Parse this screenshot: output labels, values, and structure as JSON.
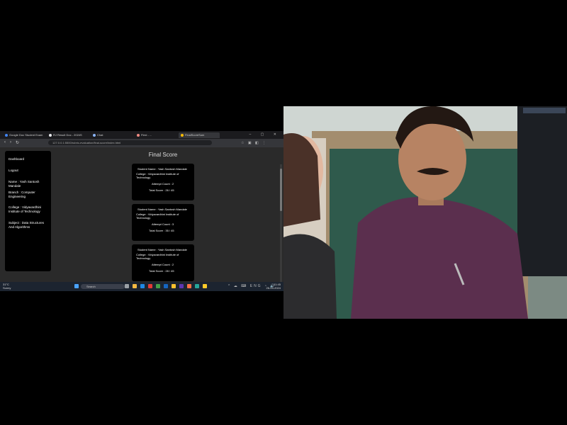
{
  "browser": {
    "tabs": [
      {
        "label": "Google Doc Student Exam",
        "active": false,
        "color": "#4285f4"
      },
      {
        "label": "RJ Result Doc - 2024S",
        "active": false,
        "color": "#e8eaed"
      },
      {
        "label": "Chat",
        "active": false,
        "color": "#8ab4f8"
      },
      {
        "label": "Flexi - ...",
        "active": false,
        "color": "#f28b82"
      },
      {
        "label": "FinalScoreSum",
        "active": true,
        "color": "#fbbc04"
      }
    ],
    "window_controls": "– ▢ ✕",
    "nav": {
      "back": "‹",
      "forward": "›",
      "reload": "↻"
    },
    "url": "127.0.0.1:5500/rubric-evaluation/final-score/index.html",
    "extension_icons": "☆ ▣ ◧ ⋮"
  },
  "sidebar": {
    "items": [
      "Dashboard",
      "Logout",
      "Name : Yash Santosh Mandale",
      "Branch : Computer Engineering",
      "College : Vidyavardhini Institute of Technology",
      "Subject : Data Structures And Algorithms"
    ]
  },
  "main": {
    "title": "Final Score",
    "cards": [
      {
        "name_line": "Student Name : Yash Santosh Mandale",
        "college_line1": "College : Vidyavardhini Institute of",
        "college_line2": "Technology",
        "attempt": "Attempt Count : 2",
        "score": "Total Score : 26 / 45"
      },
      {
        "name_line": "Student Name : Yash Santosh Mandale",
        "college_line1": "College : Vidyavardhini Institute of",
        "college_line2": "Technology",
        "attempt": "Attempt Count : 3",
        "score": "Total Score : 35 / 45"
      },
      {
        "name_line": "Student Name : Yash Santosh Mandale",
        "college_line1": "College : Vidyavardhini Institute of",
        "college_line2": "Technology",
        "attempt": "Attempt Count : 2",
        "score": "Total Score : 28 / 45"
      }
    ]
  },
  "taskbar": {
    "weather_temp": "31°C",
    "weather_desc": "Sunny",
    "search_placeholder": "Search",
    "time": "11:45",
    "date": "26-03-2024",
    "tray_icons": "^ ☁ ⌨ ENG ◔ 🔊"
  },
  "webcam": {
    "label": "Webcam video feed"
  }
}
